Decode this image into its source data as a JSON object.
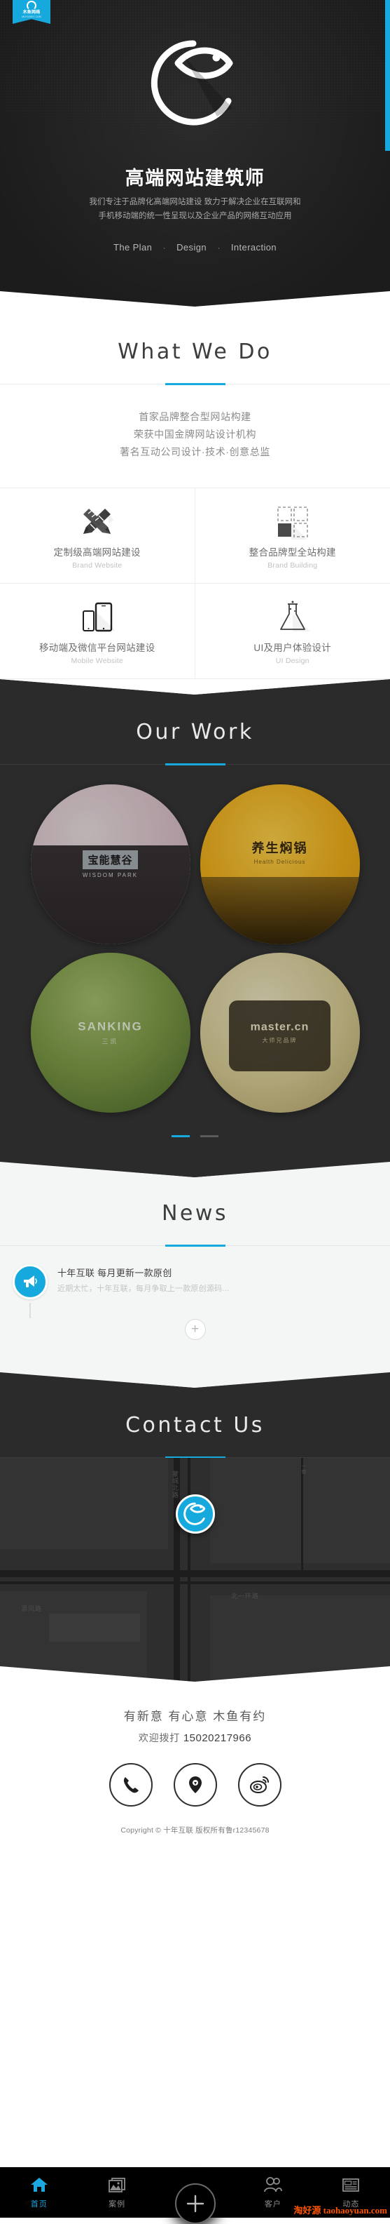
{
  "brand": {
    "ribbon_name": "木鱼网络",
    "ribbon_domain": "MUYU0007.COM",
    "logo_icon": "fish-eye-logo-icon"
  },
  "hero": {
    "title": "高端网站建筑师",
    "subtitle_line1": "我们专注于品牌化高端网站建设  致力于解决企业在互联网和",
    "subtitle_line2": "手机移动端的统一性呈现以及企业产品的网络互动应用",
    "nav": [
      {
        "label": "The Plan"
      },
      {
        "label": "Design"
      },
      {
        "label": "Interaction"
      }
    ],
    "nav_separator": "·",
    "accent_color": "#15a9dd",
    "background_color": "#2b2b2b"
  },
  "what_we_do": {
    "heading": "What We Do",
    "lines": [
      "首家品牌整合型网站构建",
      "荣获中国金牌网站设计机构",
      "著名互动公司设计·技术·创意总监"
    ],
    "services": [
      {
        "title": "定制级高端网站建设",
        "subtitle": "Brand Website",
        "icon": "pencil-ruler-icon"
      },
      {
        "title": "整合品牌型全站构建",
        "subtitle": "Brand Building",
        "icon": "grid-squares-icon"
      },
      {
        "title": "移动端及微信平台网站建设",
        "subtitle": "Mobile Website",
        "icon": "phone-tablet-icon"
      },
      {
        "title": "UI及用户体验设计",
        "subtitle": "UI Design",
        "icon": "flask-icon"
      }
    ]
  },
  "our_work": {
    "heading": "Our Work",
    "items": [
      {
        "name": "宝能慧谷",
        "sub": "WISDOM PARK",
        "color_a": "#e3c9cf",
        "color_b": "#cbadb6"
      },
      {
        "name": "养生焖锅",
        "sub": "Health Delicious",
        "color_a": "#f4b81c",
        "color_b": "#e2a313"
      },
      {
        "name": "SANKING",
        "sub": "三凯",
        "color_a": "#7b9a4a",
        "color_b": "#5c7a33"
      },
      {
        "name": "master.cn",
        "sub": "大师兄品牌",
        "color_a": "#d8cf9f",
        "color_b": "#b8ab73"
      }
    ],
    "pagination": {
      "total": 2,
      "active": 1
    }
  },
  "news": {
    "heading": "News",
    "items": [
      {
        "title": "十年互联 每月更新一款原创",
        "desc": "近期太忙，十年互联，每月争取上一款原创源码...",
        "icon": "megaphone-icon"
      }
    ],
    "more_label": "+"
  },
  "contact": {
    "heading": "Contact Us",
    "map": {
      "pin_icon": "fish-eye-logo-icon",
      "labels": [
        "源凤路",
        "北一环路",
        "蒙城北路",
        "一巷"
      ]
    }
  },
  "footer": {
    "slogan": "有新意  有心意  木鱼有约",
    "call_prefix": "欢迎拨打",
    "phone": "15020217966",
    "social": [
      {
        "name": "phone-icon"
      },
      {
        "name": "location-pin-icon"
      },
      {
        "name": "weibo-icon"
      }
    ],
    "copyright": "Copyright © 十年互联 版权所有鲁r12345678"
  },
  "tabbar": {
    "items": [
      {
        "label": "首页",
        "icon": "home-icon",
        "active": true
      },
      {
        "label": "案例",
        "icon": "gallery-icon",
        "active": false
      },
      {
        "label": "",
        "icon": "plus-icon",
        "active": false
      },
      {
        "label": "客户",
        "icon": "users-icon",
        "active": false
      },
      {
        "label": "动态",
        "icon": "news-paper-icon",
        "active": false
      }
    ],
    "active_color": "#1ba7e0"
  },
  "watermark": {
    "cn": "淘好源",
    "en": "taohaoyuan.com"
  }
}
